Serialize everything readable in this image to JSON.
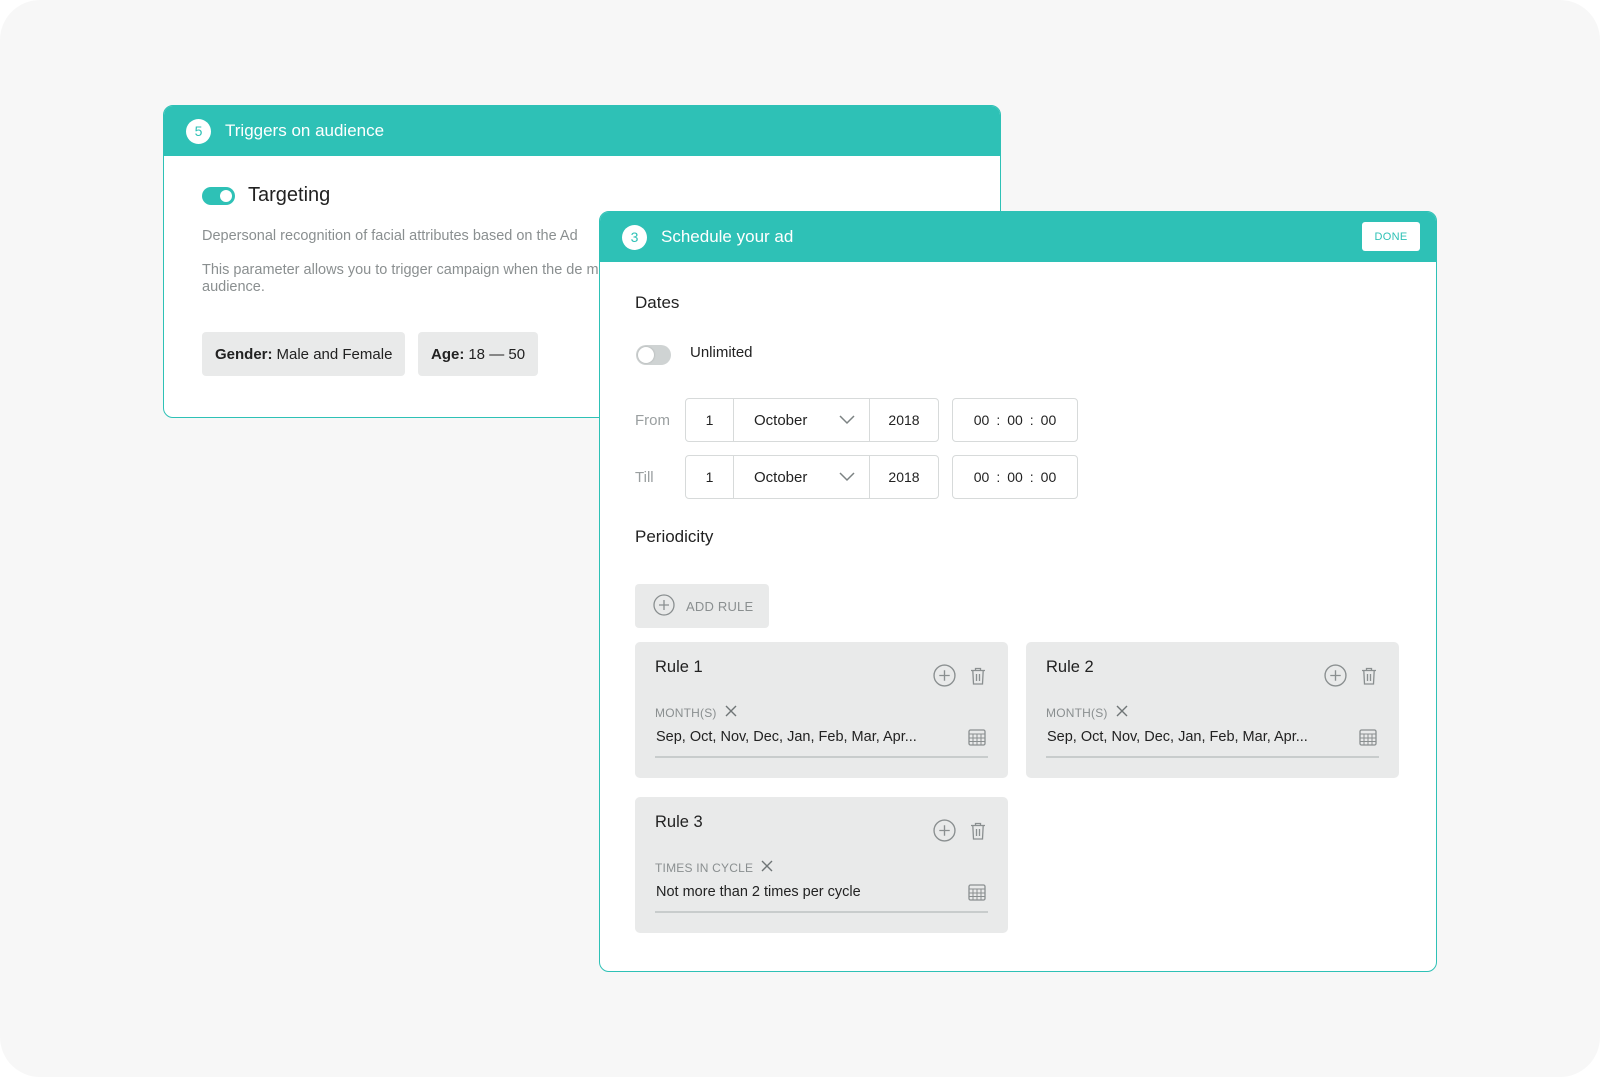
{
  "back_card": {
    "step": "5",
    "title": "Triggers on audience",
    "targeting_label": "Targeting",
    "description1": "Depersonal recognition of facial attributes based on the Ad",
    "description2": "This parameter allows you to trigger campaign when the de matches the selected audience.",
    "gender_key": "Gender:",
    "gender_value": "Male and Female",
    "age_key": "Age:",
    "age_value": "18 — 50"
  },
  "front_card": {
    "step": "3",
    "title": "Schedule your ad",
    "done_label": "DONE",
    "dates_title": "Dates",
    "unlimited_label": "Unlimited",
    "from": {
      "label": "From",
      "day": "1",
      "month": "October",
      "year": "2018",
      "hh": "00",
      "mm": "00",
      "ss": "00"
    },
    "till": {
      "label": "Till",
      "day": "1",
      "month": "October",
      "year": "2018",
      "hh": "00",
      "mm": "00",
      "ss": "00"
    },
    "periodicity_title": "Periodicity",
    "add_rule_label": "ADD RULE",
    "rules": [
      {
        "title": "Rule 1",
        "field_label": "MONTH(S)",
        "value": "Sep, Oct, Nov, Dec, Jan, Feb, Mar, Apr..."
      },
      {
        "title": "Rule 2",
        "field_label": "MONTH(S)",
        "value": "Sep, Oct, Nov, Dec, Jan, Feb, Mar, Apr..."
      },
      {
        "title": "Rule 3",
        "field_label": "TIMES IN CYCLE",
        "value": "Not more than 2 times per cycle"
      }
    ]
  },
  "icons": [
    "plus-circle-icon",
    "trash-icon",
    "close-icon",
    "calendar-icon",
    "chevron-down-icon"
  ],
  "colors": {
    "accent": "#2ec1b6",
    "chip_bg": "#e9eaea",
    "muted_text": "#8a8f90"
  },
  "state": {
    "targeting_on": true,
    "unlimited_on": false
  }
}
